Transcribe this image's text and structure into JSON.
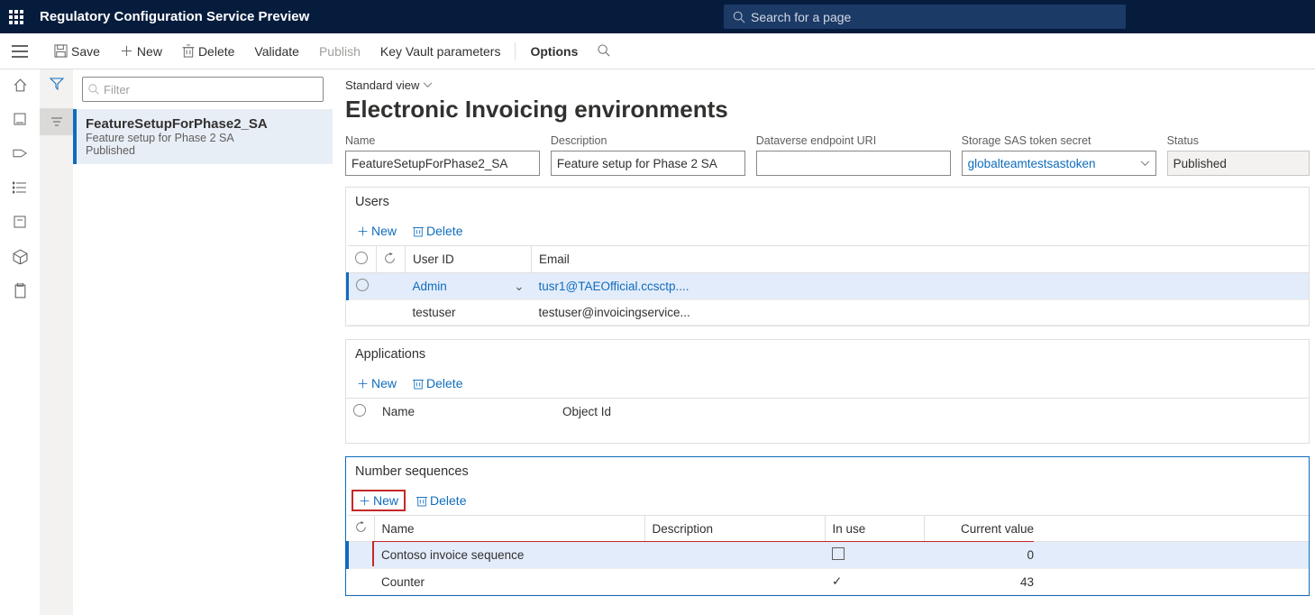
{
  "header": {
    "title": "Regulatory Configuration Service Preview",
    "search_placeholder": "Search for a page"
  },
  "cmdbar": {
    "save": "Save",
    "new": "New",
    "delete": "Delete",
    "validate": "Validate",
    "publish": "Publish",
    "kv": "Key Vault parameters",
    "options": "Options"
  },
  "list": {
    "filter_placeholder": "Filter",
    "items": [
      {
        "name": "FeatureSetupForPhase2_SA",
        "desc": "Feature setup for Phase 2 SA",
        "status": "Published"
      }
    ]
  },
  "detail": {
    "view": "Standard view",
    "title": "Electronic Invoicing environments",
    "fields": {
      "name_label": "Name",
      "name_value": "FeatureSetupForPhase2_SA",
      "desc_label": "Description",
      "desc_value": "Feature setup for Phase 2 SA",
      "dv_label": "Dataverse endpoint URI",
      "dv_value": "",
      "sas_label": "Storage SAS token secret",
      "sas_value": "globalteamtestsastoken",
      "status_label": "Status",
      "status_value": "Published"
    },
    "users": {
      "title": "Users",
      "new": "New",
      "delete": "Delete",
      "cols": {
        "userid": "User ID",
        "email": "Email"
      },
      "rows": [
        {
          "userid": "Admin",
          "email": "tusr1@TAEOfficial.ccsctp...."
        },
        {
          "userid": "testuser",
          "email": "testuser@invoicingservice..."
        }
      ]
    },
    "apps": {
      "title": "Applications",
      "new": "New",
      "delete": "Delete",
      "cols": {
        "name": "Name",
        "objectid": "Object Id"
      }
    },
    "seq": {
      "title": "Number sequences",
      "new": "New",
      "delete": "Delete",
      "cols": {
        "name": "Name",
        "desc": "Description",
        "inuse": "In use",
        "curval": "Current value"
      },
      "rows": [
        {
          "name": "Contoso invoice sequence",
          "desc": "",
          "inuse": false,
          "curval": "0"
        },
        {
          "name": "Counter",
          "desc": "",
          "inuse": true,
          "curval": "43"
        }
      ]
    }
  }
}
